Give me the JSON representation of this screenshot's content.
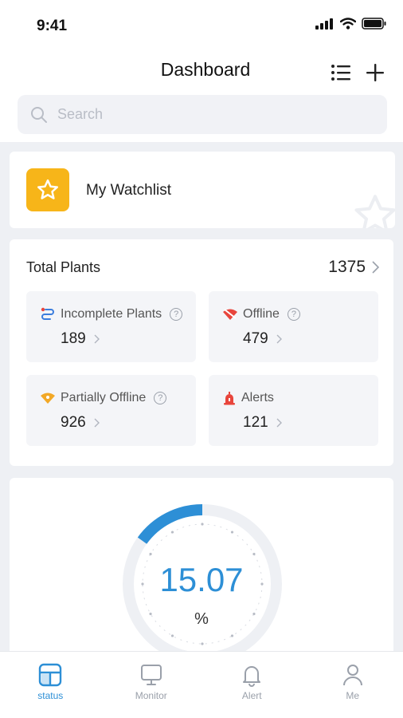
{
  "status_bar": {
    "time": "9:41"
  },
  "header": {
    "title": "Dashboard"
  },
  "search": {
    "placeholder": "Search"
  },
  "watchlist": {
    "label": "My Watchlist"
  },
  "plants": {
    "title": "Total Plants",
    "total": "1375",
    "tiles": [
      {
        "label": "Incomplete Plants",
        "value": "189"
      },
      {
        "label": "Offline",
        "value": "479"
      },
      {
        "label": "Partially Offline",
        "value": "926"
      },
      {
        "label": "Alerts",
        "value": "121"
      }
    ]
  },
  "gauge": {
    "value": "15.07",
    "unit": "%",
    "fraction": 0.1507
  },
  "tabs": [
    {
      "label": "status",
      "active": true
    },
    {
      "label": "Monitor",
      "active": false
    },
    {
      "label": "Alert",
      "active": false
    },
    {
      "label": "Me",
      "active": false
    }
  ],
  "colors": {
    "accent": "#2d8fd6",
    "watch": "#f7b519",
    "offline": "#e8453c",
    "partial": "#f2a826",
    "incomplete": "#3b7ddd"
  }
}
